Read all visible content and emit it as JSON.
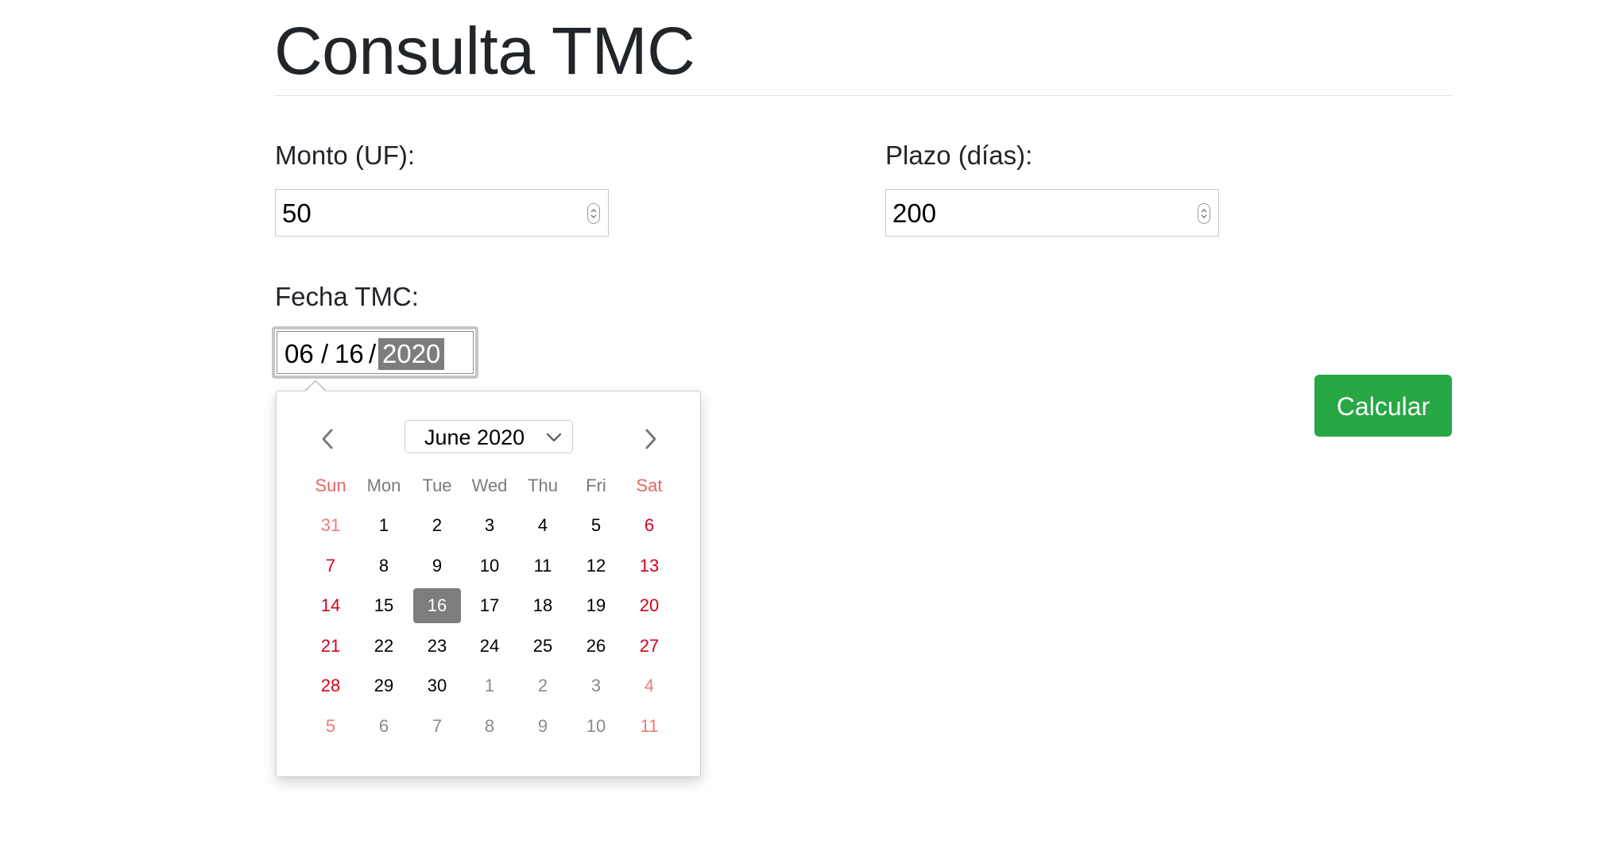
{
  "page": {
    "title": "Consulta TMC"
  },
  "form": {
    "monto_label": "Monto (UF):",
    "monto_value": "50",
    "plazo_label": "Plazo (días):",
    "plazo_value": "200",
    "fecha_label": "Fecha TMC:",
    "fecha_month": "06",
    "fecha_day": "16",
    "fecha_year": "2020",
    "separator": "/",
    "calcular_label": "Calcular",
    "calcular_color": "#28a745"
  },
  "calendar": {
    "month_label": "June 2020",
    "prev_icon": "chevron-left-icon",
    "next_icon": "chevron-right-icon",
    "weekdays": [
      "Sun",
      "Mon",
      "Tue",
      "Wed",
      "Thu",
      "Fri",
      "Sat"
    ],
    "weeks": [
      [
        {
          "d": "31",
          "other": true
        },
        {
          "d": "1"
        },
        {
          "d": "2"
        },
        {
          "d": "3"
        },
        {
          "d": "4"
        },
        {
          "d": "5"
        },
        {
          "d": "6"
        }
      ],
      [
        {
          "d": "7"
        },
        {
          "d": "8"
        },
        {
          "d": "9"
        },
        {
          "d": "10"
        },
        {
          "d": "11"
        },
        {
          "d": "12"
        },
        {
          "d": "13"
        }
      ],
      [
        {
          "d": "14"
        },
        {
          "d": "15"
        },
        {
          "d": "16",
          "selected": true
        },
        {
          "d": "17"
        },
        {
          "d": "18"
        },
        {
          "d": "19"
        },
        {
          "d": "20"
        }
      ],
      [
        {
          "d": "21"
        },
        {
          "d": "22"
        },
        {
          "d": "23"
        },
        {
          "d": "24"
        },
        {
          "d": "25"
        },
        {
          "d": "26"
        },
        {
          "d": "27"
        }
      ],
      [
        {
          "d": "28"
        },
        {
          "d": "29"
        },
        {
          "d": "30"
        },
        {
          "d": "1",
          "other": true
        },
        {
          "d": "2",
          "other": true
        },
        {
          "d": "3",
          "other": true
        },
        {
          "d": "4",
          "other": true
        }
      ],
      [
        {
          "d": "5",
          "other": true
        },
        {
          "d": "6",
          "other": true
        },
        {
          "d": "7",
          "other": true
        },
        {
          "d": "8",
          "other": true
        },
        {
          "d": "9",
          "other": true
        },
        {
          "d": "10",
          "other": true
        },
        {
          "d": "11",
          "other": true
        }
      ]
    ],
    "weekend_color": "#d0021b",
    "selected_bg": "#7d7d7d"
  }
}
